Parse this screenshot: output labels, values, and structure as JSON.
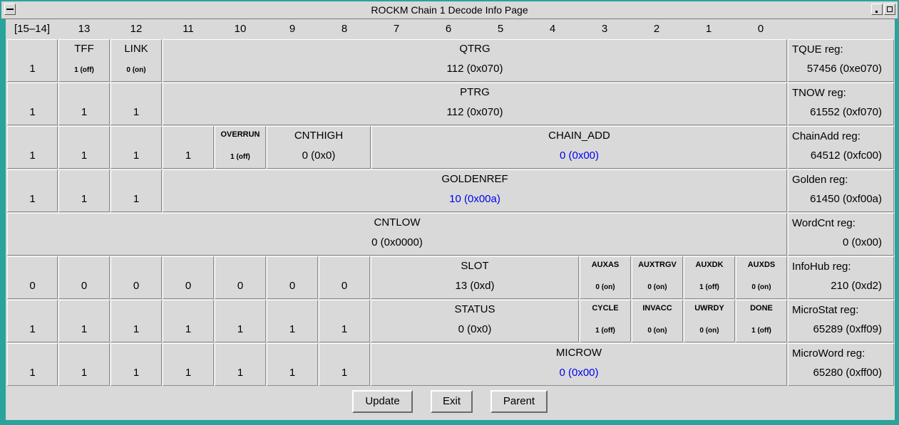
{
  "window": {
    "title": "ROCKM Chain 1 Decode Info Page"
  },
  "header": {
    "bits": [
      "[15–14]",
      "13",
      "12",
      "11",
      "10",
      "9",
      "8",
      "7",
      "6",
      "5",
      "4",
      "3",
      "2",
      "1",
      "0"
    ]
  },
  "rows": {
    "tque": {
      "cells": [
        {
          "name": "",
          "value": "1"
        },
        {
          "name": "TFF",
          "value": "1 (off)"
        },
        {
          "name": "LINK",
          "value": "0 (on)"
        },
        {
          "name": "QTRG",
          "value": "112 (0x070)"
        }
      ],
      "reg_label": "TQUE reg:",
      "reg_value": "57456 (0xe070)"
    },
    "tnow": {
      "cells": [
        {
          "name": "",
          "value": "1"
        },
        {
          "name": "",
          "value": "1"
        },
        {
          "name": "",
          "value": "1"
        },
        {
          "name": "PTRG",
          "value": "112 (0x070)"
        }
      ],
      "reg_label": "TNOW reg:",
      "reg_value": "61552 (0xf070)"
    },
    "chainadd": {
      "cells": [
        {
          "name": "",
          "value": "1"
        },
        {
          "name": "",
          "value": "1"
        },
        {
          "name": "",
          "value": "1"
        },
        {
          "name": "",
          "value": "1"
        },
        {
          "name": "OVERRUN",
          "value": "1 (off)"
        },
        {
          "name": "CNTHIGH",
          "value": "0 (0x0)"
        },
        {
          "name": "CHAIN_ADD",
          "value": "0 (0x00)"
        }
      ],
      "reg_label": "ChainAdd reg:",
      "reg_value": "64512 (0xfc00)"
    },
    "golden": {
      "cells": [
        {
          "name": "",
          "value": "1"
        },
        {
          "name": "",
          "value": "1"
        },
        {
          "name": "",
          "value": "1"
        },
        {
          "name": "GOLDENREF",
          "value": "10 (0x00a)"
        }
      ],
      "reg_label": "Golden reg:",
      "reg_value": "61450 (0xf00a)"
    },
    "wordcnt": {
      "cells": [
        {
          "name": "CNTLOW",
          "value": "0 (0x0000)"
        }
      ],
      "reg_label": "WordCnt reg:",
      "reg_value": "0 (0x00)"
    },
    "infohub": {
      "cells": [
        {
          "name": "",
          "value": "0"
        },
        {
          "name": "",
          "value": "0"
        },
        {
          "name": "",
          "value": "0"
        },
        {
          "name": "",
          "value": "0"
        },
        {
          "name": "",
          "value": "0"
        },
        {
          "name": "",
          "value": "0"
        },
        {
          "name": "",
          "value": "0"
        },
        {
          "name": "SLOT",
          "value": "13 (0xd)"
        },
        {
          "name": "AUXAS",
          "value": "0 (on)"
        },
        {
          "name": "AUXTRGV",
          "value": "0 (on)"
        },
        {
          "name": "AUXDK",
          "value": "1 (off)"
        },
        {
          "name": "AUXDS",
          "value": "0 (on)"
        }
      ],
      "reg_label": "InfoHub reg:",
      "reg_value": "210 (0xd2)"
    },
    "microstat": {
      "cells": [
        {
          "name": "",
          "value": "1"
        },
        {
          "name": "",
          "value": "1"
        },
        {
          "name": "",
          "value": "1"
        },
        {
          "name": "",
          "value": "1"
        },
        {
          "name": "",
          "value": "1"
        },
        {
          "name": "",
          "value": "1"
        },
        {
          "name": "",
          "value": "1"
        },
        {
          "name": "STATUS",
          "value": "0 (0x0)"
        },
        {
          "name": "CYCLE",
          "value": "1 (off)"
        },
        {
          "name": "INVACC",
          "value": "0 (on)"
        },
        {
          "name": "UWRDY",
          "value": "0 (on)"
        },
        {
          "name": "DONE",
          "value": "1 (off)"
        }
      ],
      "reg_label": "MicroStat reg:",
      "reg_value": "65289 (0xff09)"
    },
    "microword": {
      "cells": [
        {
          "name": "",
          "value": "1"
        },
        {
          "name": "",
          "value": "1"
        },
        {
          "name": "",
          "value": "1"
        },
        {
          "name": "",
          "value": "1"
        },
        {
          "name": "",
          "value": "1"
        },
        {
          "name": "",
          "value": "1"
        },
        {
          "name": "",
          "value": "1"
        },
        {
          "name": "MICROW",
          "value": "0 (0x00)"
        }
      ],
      "reg_label": "MicroWord reg:",
      "reg_value": "65280 (0xff00)"
    }
  },
  "colors": {
    "highlight_value": "#0000ee",
    "frame": "#2aa39a",
    "panel": "#d9d9d9"
  },
  "buttons": {
    "update": "Update",
    "exit": "Exit",
    "parent": "Parent"
  }
}
